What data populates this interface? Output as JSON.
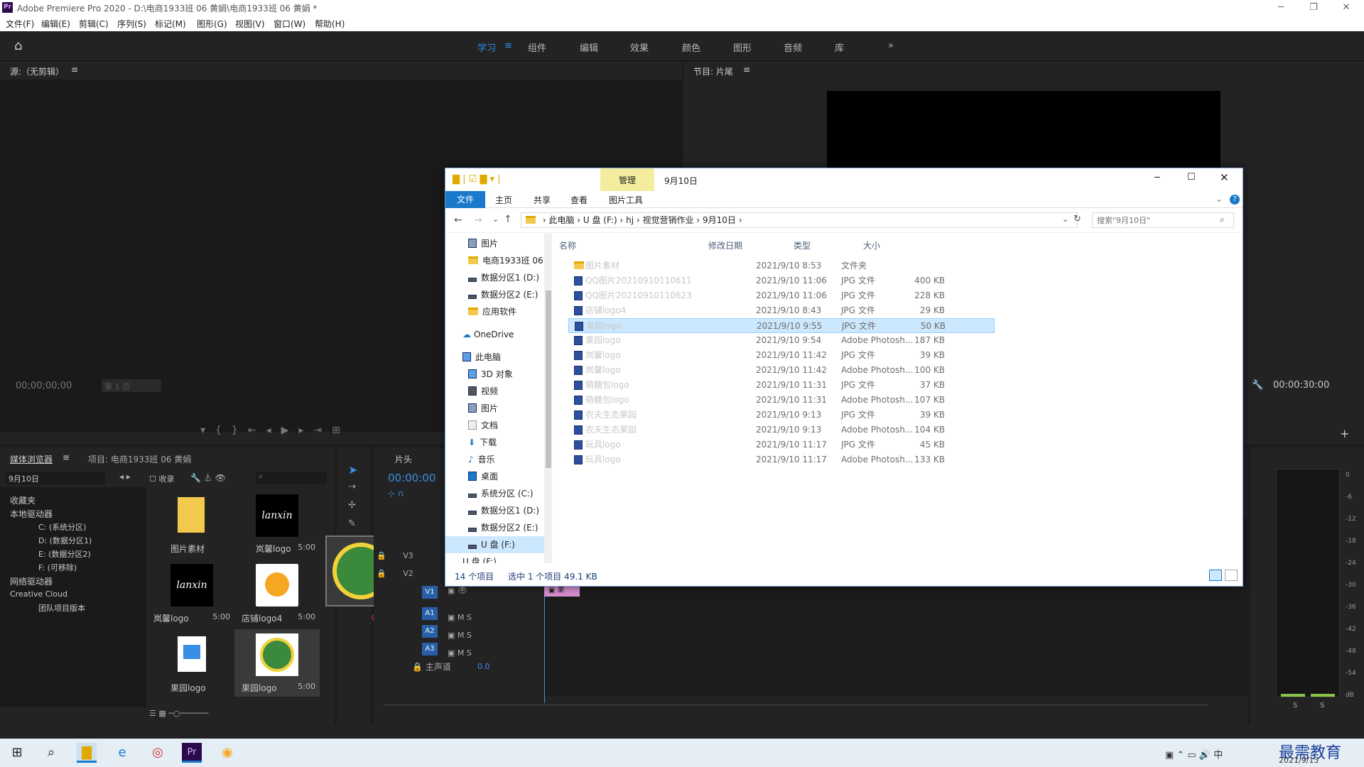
{
  "app": {
    "title": "Adobe Premiere Pro 2020 - D:\\电商1933班  06  黄娟\\电商1933班  06  黄娟 *",
    "logo": "Pr"
  },
  "menu": [
    "文件(F)",
    "编辑(E)",
    "剪辑(C)",
    "序列(S)",
    "标记(M)",
    "图形(G)",
    "视图(V)",
    "窗口(W)",
    "帮助(H)"
  ],
  "workspaces": [
    "学习",
    "组件",
    "编辑",
    "效果",
    "颜色",
    "图形",
    "音频",
    "库"
  ],
  "source_panel": {
    "title": "源:（无剪辑）",
    "timecode": "00;00;00;00",
    "page": "第 1 页"
  },
  "program_panel": {
    "title": "节目: 片尾",
    "timecode": "00:00:30:00"
  },
  "media_browser": {
    "tab1": "媒体浏览器",
    "tab2": "项目: 电商1933班  06  黄娟",
    "folder": "9月10日",
    "collect_label": "收录",
    "tree": [
      "收藏夹",
      "本地驱动器",
      "C: (系统分区)",
      "D: (数据分区1)",
      "E: (数据分区2)",
      "F: (可移除)",
      "网络驱动器",
      "Creative Cloud",
      "团队项目版本"
    ],
    "thumbs": [
      {
        "name": "图片素材",
        "dur": ""
      },
      {
        "name": "岚馨logo",
        "dur": "5:00"
      },
      {
        "name": "岚馨logo",
        "dur": "5:00"
      },
      {
        "name": "店铺logo4",
        "dur": "5:00"
      },
      {
        "name": "果园logo",
        "dur": ""
      },
      {
        "name": "果园logo",
        "dur": "5:00"
      }
    ]
  },
  "timeline": {
    "title": "片头",
    "timecode": "00:00:00",
    "tracks": [
      "V3",
      "V2",
      "V1",
      "A1",
      "A2",
      "A3"
    ],
    "master": "主声道",
    "master_val": "0.0",
    "m": "M",
    "s": "S"
  },
  "meters": {
    "labels": [
      "0",
      "-6",
      "-12",
      "-18",
      "-24",
      "-30",
      "-36",
      "-42",
      "-48",
      "-54",
      "dB"
    ],
    "s": "S"
  },
  "explorer": {
    "title": "9月10日",
    "manage": "管理",
    "picture_tools": "图片工具",
    "ribbon": [
      "文件",
      "主页",
      "共享",
      "查看"
    ],
    "path": [
      "此电脑",
      "U 盘 (F:)",
      "hj",
      "视觉营销作业",
      "9月10日"
    ],
    "search_placeholder": "搜索\"9月10日\"",
    "nav": [
      "图片",
      "电商1933班  06",
      "数据分区1 (D:)",
      "数据分区2 (E:)",
      "应用软件",
      "OneDrive",
      "此电脑",
      "3D 对象",
      "视频",
      "图片",
      "文档",
      "下载",
      "音乐",
      "桌面",
      "系统分区 (C:)",
      "数据分区1 (D:)",
      "数据分区2 (E:)",
      "U 盘 (F:)",
      "U 盘 (F:)"
    ],
    "columns": [
      "名称",
      "修改日期",
      "类型",
      "大小"
    ],
    "files": [
      {
        "name": "图片素材",
        "date": "2021/9/10 8:53",
        "type": "文件夹",
        "size": ""
      },
      {
        "name": "QQ图片20210910110611",
        "date": "2021/9/10 11:06",
        "type": "JPG 文件",
        "size": "400 KB"
      },
      {
        "name": "QQ图片20210910110623",
        "date": "2021/9/10 11:06",
        "type": "JPG 文件",
        "size": "228 KB"
      },
      {
        "name": "店铺logo4",
        "date": "2021/9/10 8:43",
        "type": "JPG 文件",
        "size": "29 KB"
      },
      {
        "name": "果园logo",
        "date": "2021/9/10 9:55",
        "type": "JPG 文件",
        "size": "50 KB"
      },
      {
        "name": "果园logo",
        "date": "2021/9/10 9:54",
        "type": "Adobe Photosh...",
        "size": "187 KB"
      },
      {
        "name": "岚馨logo",
        "date": "2021/9/10 11:42",
        "type": "JPG 文件",
        "size": "39 KB"
      },
      {
        "name": "岚馨logo",
        "date": "2021/9/10 11:42",
        "type": "Adobe Photosh...",
        "size": "100 KB"
      },
      {
        "name": "萌糖包logo",
        "date": "2021/9/10 11:31",
        "type": "JPG 文件",
        "size": "37 KB"
      },
      {
        "name": "萌糖包logo",
        "date": "2021/9/10 11:31",
        "type": "Adobe Photosh...",
        "size": "107 KB"
      },
      {
        "name": "农夫生态果园",
        "date": "2021/9/10 9:13",
        "type": "JPG 文件",
        "size": "39 KB"
      },
      {
        "name": "农夫生态果园",
        "date": "2021/9/10 9:13",
        "type": "Adobe Photosh...",
        "size": "104 KB"
      },
      {
        "name": "玩具logo",
        "date": "2021/9/10 11:17",
        "type": "JPG 文件",
        "size": "45 KB"
      },
      {
        "name": "玩具logo",
        "date": "2021/9/10 11:17",
        "type": "Adobe Photosh...",
        "size": "133 KB"
      }
    ],
    "status": {
      "count": "14 个项目",
      "selected": "选中 1 个项目  49.1 KB"
    }
  },
  "taskbar": {
    "time": "2021/9/13",
    "ime": "中",
    "watermark": "最需教育"
  }
}
